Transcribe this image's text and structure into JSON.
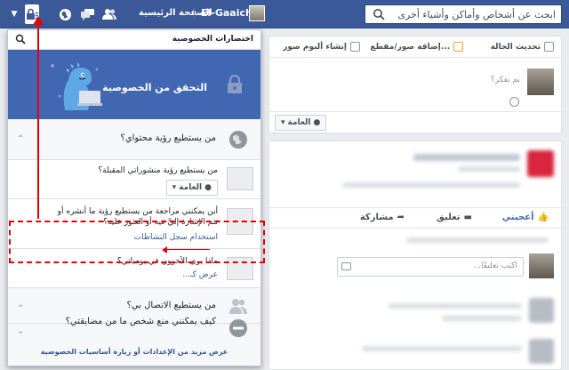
{
  "topbar": {
    "home_label": "الصفحة الرئيسية",
    "user_name": "El-Gaaichi",
    "search_placeholder": "ابحث عن أشخاص وأماكن وأشياء أخرى"
  },
  "privacy_panel": {
    "header_title": "اختصارات الخصوصية",
    "banner_title": "التحقق من الخصوصية",
    "sections": [
      {
        "title": "من يستطيع رؤية محتواي؟",
        "state": "expanded"
      },
      {
        "title": "من يستطيع الاتصال بي؟",
        "state": "collapsed"
      },
      {
        "title": "كيف يمكنني منع شخص ما من مضايقتي؟",
        "state": "collapsed"
      }
    ],
    "subitems": [
      {
        "title": "من يستطيع رؤية منشوراتي المقبلة؟",
        "control": "العامة"
      },
      {
        "title": "أين يمكنني مراجعة من يستطيع رؤية ما أنشره أو تتم الإشارة إليَّ فيه أو العثور عليه؟",
        "link": "استخدام سجل النشاطات"
      },
      {
        "title": "ماذا يرى الآخرون في يومياتي؟",
        "link": "عرض كـ..."
      }
    ],
    "footer_link": "عرض مزيد من الإعدادات أو زيارة أساسيات الخصوصية"
  },
  "composer": {
    "tabs": [
      "تحديث الحالة",
      "إضافة صور/مقطع...",
      "إنشاء ألبوم صور"
    ],
    "placeholder": "بم تفكر؟",
    "audience": "العامة"
  },
  "feed": {
    "actions": [
      "أعجبني",
      "تعليق",
      "مشاركة"
    ],
    "comment_placeholder": "اكتب تعليقًا..."
  },
  "colors": {
    "brand_blue": "#3b5998",
    "banner_blue": "#4267b2",
    "annotation_red": "#e60000"
  }
}
